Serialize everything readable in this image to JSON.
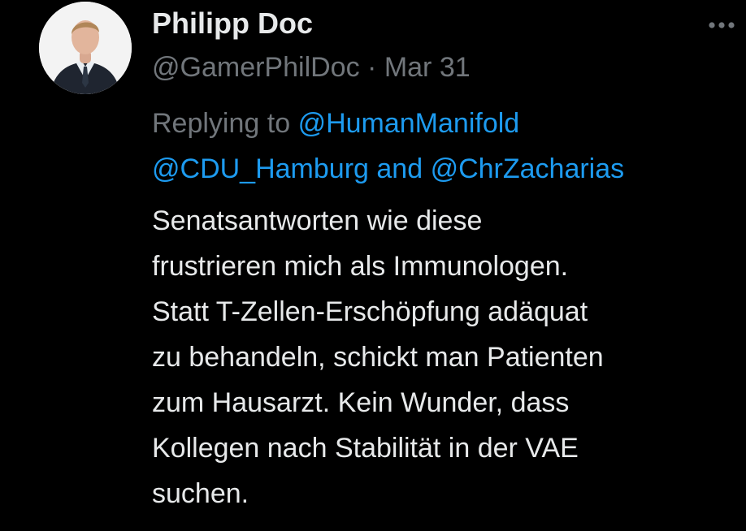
{
  "author": {
    "display_name": "Philipp Doc",
    "handle": "@GamerPhilDoc",
    "separator": "·",
    "date": "Mar 31"
  },
  "reply": {
    "prefix": "Replying to",
    "mention_1": "@HumanManifold",
    "mention_2": "@CDU_Hamburg",
    "conjunction": "and",
    "mention_3": "@ChrZacharias"
  },
  "body_lines": [
    "Senatsantworten wie diese",
    "frustrieren mich als Immunologen.",
    "Statt T-Zellen-Erschöpfung adäquat",
    "zu behandeln, schickt man Patienten",
    "zum Hausarzt. Kein Wunder, dass",
    "Kollegen nach Stabilität in der VAE",
    "suchen."
  ],
  "icons": {
    "more": "more-horizontal-icon",
    "avatar": "avatar-photo"
  },
  "colors": {
    "background": "#000000",
    "text_primary": "#e7e9ea",
    "text_secondary": "#71767b",
    "accent_link": "#1d9bf0"
  }
}
